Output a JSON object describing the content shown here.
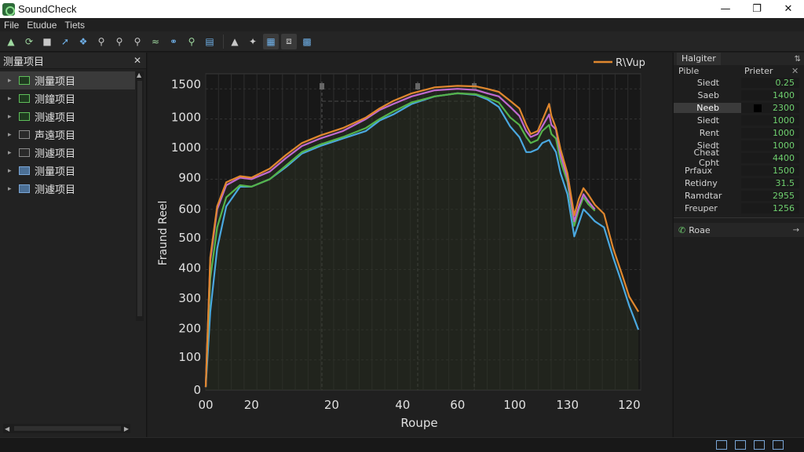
{
  "window": {
    "title": "SoundCheck",
    "controls": [
      "minimize",
      "maximize",
      "close"
    ]
  },
  "menu": [
    "File",
    "Etudue",
    "Tiets"
  ],
  "toolbar": {
    "icons": [
      "new-file-icon",
      "refresh-icon",
      "folder-icon",
      "pencil-icon",
      "tools-icon",
      "zoom-icon",
      "zoom-out-icon",
      "zoom-reset-icon",
      "measure-icon",
      "link-icon",
      "probe-icon",
      "calibrate-icon",
      "pin-icon",
      "snap-icon",
      "grid-icon",
      "cursor-icon",
      "layer-icon"
    ]
  },
  "left_panel": {
    "title": "测量项目",
    "items": [
      {
        "label": "测量项目",
        "icon": "green",
        "selected": true
      },
      {
        "label": "测鐘项目",
        "icon": "green",
        "selected": false
      },
      {
        "label": "测遽项目",
        "icon": "green",
        "selected": false
      },
      {
        "label": "声遠项目",
        "icon": "gray",
        "selected": false
      },
      {
        "label": "测遽项目",
        "icon": "gray",
        "selected": false
      },
      {
        "label": "测量项目",
        "icon": "blue",
        "selected": false
      },
      {
        "label": "测遽项目",
        "icon": "blue",
        "selected": false
      }
    ]
  },
  "chart_data": {
    "type": "line",
    "legend": "R\\Vup",
    "legend_position": "top-right",
    "xlabel": "Roupe",
    "ylabel": "Fraund Reel",
    "x_ticks": [
      "00",
      "20",
      "20",
      "40",
      "60",
      "100",
      "130",
      "120"
    ],
    "y_ticks": [
      "0",
      "100",
      "200",
      "300",
      "400",
      "500",
      "600",
      "900",
      "1000",
      "1000",
      "1500"
    ],
    "grid": true,
    "colors": {
      "orange": "#e0872e",
      "purple": "#c06ad0",
      "green": "#55b34a",
      "blue": "#4aa8e0"
    },
    "series": [
      {
        "name": "R\\Vup",
        "color": "#e0872e",
        "points": [
          [
            0,
            10
          ],
          [
            2,
            440
          ],
          [
            5,
            610
          ],
          [
            9,
            690
          ],
          [
            15,
            710
          ],
          [
            20,
            705
          ],
          [
            28,
            735
          ],
          [
            35,
            780
          ],
          [
            42,
            820
          ],
          [
            50,
            845
          ],
          [
            60,
            870
          ],
          [
            70,
            905
          ],
          [
            76,
            935
          ],
          [
            82,
            960
          ],
          [
            90,
            985
          ],
          [
            100,
            1005
          ],
          [
            110,
            1010
          ],
          [
            118,
            1008
          ],
          [
            123,
            1000
          ],
          [
            128,
            990
          ],
          [
            133,
            960
          ],
          [
            137,
            935
          ],
          [
            140,
            880
          ],
          [
            142,
            850
          ],
          [
            145,
            860
          ],
          [
            147,
            895
          ],
          [
            150,
            950
          ],
          [
            151,
            910
          ],
          [
            153,
            870
          ],
          [
            155,
            800
          ],
          [
            158,
            720
          ],
          [
            161,
            580
          ],
          [
            163,
            635
          ],
          [
            165,
            670
          ],
          [
            167,
            650
          ],
          [
            170,
            615
          ],
          [
            174,
            585
          ],
          [
            178,
            470
          ],
          [
            182,
            380
          ],
          [
            185,
            310
          ],
          [
            189,
            260
          ]
        ]
      },
      {
        "name": "",
        "color": "#c06ad0",
        "points": [
          [
            0,
            10
          ],
          [
            2,
            430
          ],
          [
            5,
            600
          ],
          [
            9,
            680
          ],
          [
            15,
            705
          ],
          [
            20,
            700
          ],
          [
            28,
            725
          ],
          [
            35,
            770
          ],
          [
            42,
            810
          ],
          [
            50,
            835
          ],
          [
            60,
            860
          ],
          [
            70,
            900
          ],
          [
            76,
            930
          ],
          [
            82,
            950
          ],
          [
            90,
            975
          ],
          [
            100,
            995
          ],
          [
            110,
            1000
          ],
          [
            118,
            996
          ],
          [
            123,
            985
          ],
          [
            128,
            975
          ],
          [
            133,
            940
          ],
          [
            137,
            910
          ],
          [
            140,
            860
          ],
          [
            142,
            840
          ],
          [
            145,
            850
          ],
          [
            147,
            875
          ],
          [
            150,
            915
          ],
          [
            151,
            880
          ],
          [
            153,
            865
          ],
          [
            155,
            780
          ],
          [
            158,
            705
          ],
          [
            161,
            560
          ],
          [
            163,
            610
          ],
          [
            165,
            650
          ],
          [
            167,
            628
          ],
          [
            170,
            600
          ]
        ]
      },
      {
        "name": "",
        "color": "#55b34a",
        "points": [
          [
            0,
            10
          ],
          [
            2,
            370
          ],
          [
            5,
            540
          ],
          [
            9,
            640
          ],
          [
            15,
            680
          ],
          [
            20,
            675
          ],
          [
            28,
            700
          ],
          [
            35,
            745
          ],
          [
            42,
            790
          ],
          [
            50,
            815
          ],
          [
            60,
            840
          ],
          [
            70,
            870
          ],
          [
            76,
            900
          ],
          [
            82,
            925
          ],
          [
            90,
            955
          ],
          [
            100,
            975
          ],
          [
            110,
            985
          ],
          [
            118,
            982
          ],
          [
            123,
            970
          ],
          [
            128,
            955
          ],
          [
            133,
            905
          ],
          [
            137,
            880
          ],
          [
            140,
            840
          ],
          [
            142,
            820
          ],
          [
            145,
            830
          ],
          [
            147,
            860
          ],
          [
            150,
            880
          ],
          [
            151,
            850
          ],
          [
            153,
            835
          ],
          [
            155,
            760
          ],
          [
            158,
            690
          ],
          [
            161,
            545
          ],
          [
            163,
            600
          ],
          [
            165,
            640
          ],
          [
            167,
            618
          ],
          [
            170,
            595
          ]
        ]
      },
      {
        "name": "",
        "color": "#4aa8e0",
        "points": [
          [
            0,
            10
          ],
          [
            2,
            260
          ],
          [
            5,
            470
          ],
          [
            9,
            610
          ],
          [
            15,
            675
          ],
          [
            20,
            675
          ],
          [
            28,
            700
          ],
          [
            35,
            740
          ],
          [
            42,
            785
          ],
          [
            50,
            810
          ],
          [
            60,
            835
          ],
          [
            70,
            860
          ],
          [
            76,
            895
          ],
          [
            82,
            915
          ],
          [
            90,
            950
          ],
          [
            100,
            975
          ],
          [
            110,
            985
          ],
          [
            118,
            980
          ],
          [
            123,
            965
          ],
          [
            128,
            940
          ],
          [
            133,
            875
          ],
          [
            137,
            840
          ],
          [
            140,
            790
          ],
          [
            142,
            790
          ],
          [
            145,
            800
          ],
          [
            147,
            820
          ],
          [
            150,
            830
          ],
          [
            151,
            815
          ],
          [
            153,
            790
          ],
          [
            155,
            720
          ],
          [
            158,
            650
          ],
          [
            161,
            510
          ],
          [
            163,
            555
          ],
          [
            165,
            600
          ],
          [
            167,
            585
          ],
          [
            170,
            560
          ],
          [
            174,
            540
          ],
          [
            178,
            440
          ],
          [
            182,
            350
          ],
          [
            185,
            280
          ],
          [
            189,
            200
          ]
        ]
      }
    ]
  },
  "right_panel": {
    "tab": "Halgiter",
    "headers": [
      "Pible",
      "Prieter"
    ],
    "rows": [
      {
        "label": "Siedt",
        "value": "0.25",
        "align": "right",
        "selected": false
      },
      {
        "label": "Saeb",
        "value": "1400",
        "align": "right",
        "selected": false
      },
      {
        "label": "Neeb",
        "value": "2300",
        "align": "right",
        "selected": true
      },
      {
        "label": "Siedt",
        "value": "1000",
        "align": "right",
        "selected": false
      },
      {
        "label": "Rent",
        "value": "1000",
        "align": "right",
        "selected": false
      },
      {
        "label": "Siedt",
        "value": "1000",
        "align": "right",
        "selected": false
      },
      {
        "label": "Cheat Cpht",
        "value": "4400",
        "align": "right",
        "selected": false
      },
      {
        "label": "Prfaux",
        "value": "1500",
        "align": "left",
        "selected": false
      },
      {
        "label": "Retidny",
        "value": "31.5",
        "align": "left",
        "selected": false
      },
      {
        "label": "Ramdtar",
        "value": "2955",
        "align": "left",
        "selected": false
      },
      {
        "label": "Freuper",
        "value": "1256",
        "align": "left",
        "selected": false
      }
    ],
    "sub": {
      "label": "Roae"
    }
  },
  "statusbar": {
    "buttons": 4
  }
}
